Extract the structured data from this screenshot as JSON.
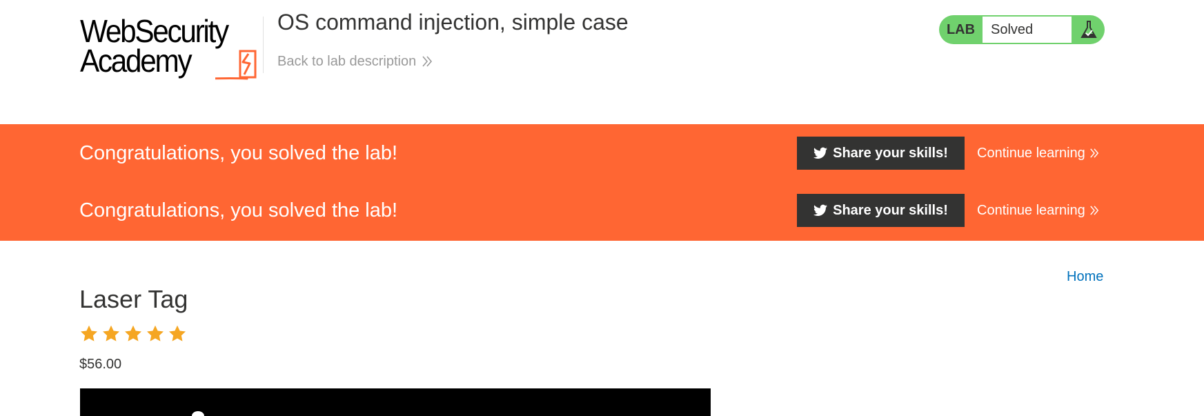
{
  "header": {
    "logo": {
      "line1": "WebSecurity",
      "line2": "Academy",
      "icon": "lightning-bolt-icon",
      "brand_color": "#ff6633"
    },
    "lab_title": "OS command injection, simple case",
    "back_link": "Back to lab description",
    "back_icon": "double-chevron-right-icon",
    "lab_status": {
      "tag": "LAB",
      "state": "Solved",
      "icon": "flask-icon",
      "color": "#70d16d"
    }
  },
  "banner": {
    "color": "#ff6633",
    "rows": [
      {
        "message": "Congratulations, you solved the lab!",
        "share_label": "Share your skills!",
        "share_icon": "twitter-icon",
        "continue_label": "Continue learning"
      },
      {
        "message": "Congratulations, you solved the lab!",
        "share_label": "Share your skills!",
        "share_icon": "twitter-icon",
        "continue_label": "Continue learning"
      }
    ]
  },
  "nav": {
    "home_label": "Home",
    "link_color": "#0071bc"
  },
  "product": {
    "title": "Laser Tag",
    "rating": 5,
    "rating_max": 5,
    "star_color": "#f5a623",
    "price": "$56.00"
  }
}
